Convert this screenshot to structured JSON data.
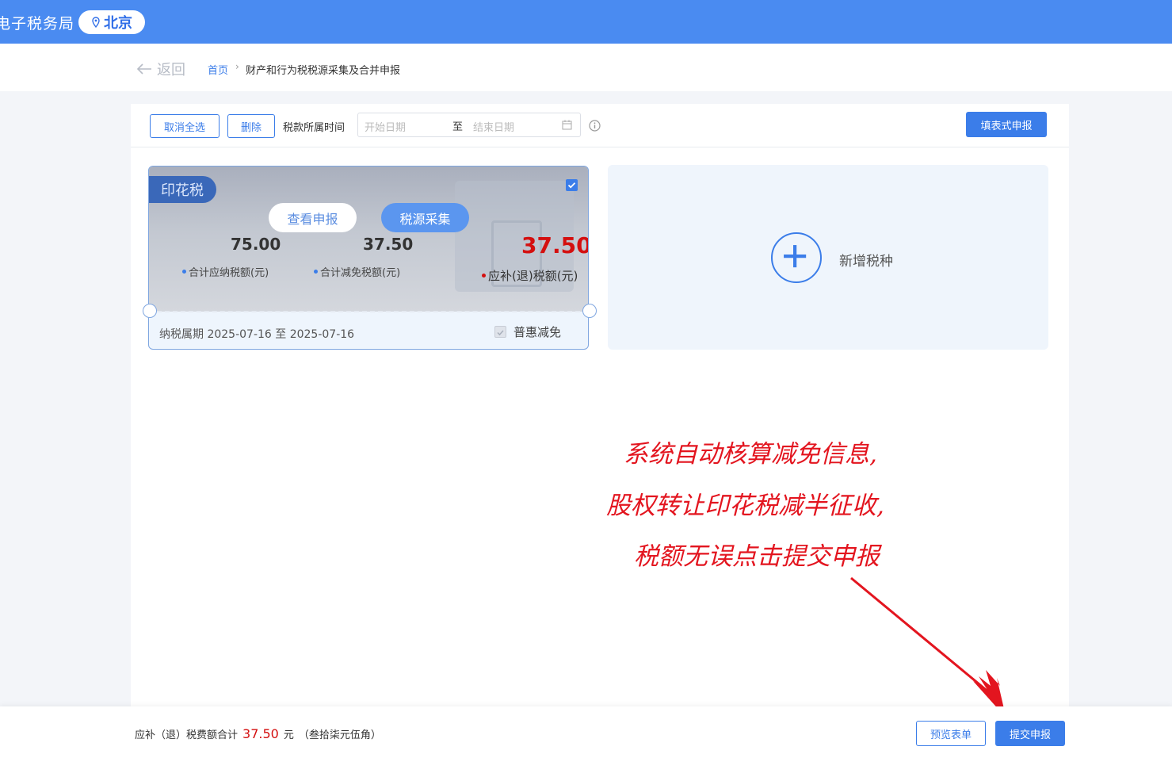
{
  "header": {
    "brand": "电子税务局",
    "location": "北京"
  },
  "breadcrumb": {
    "back": "返回",
    "home": "首页",
    "separator": "›",
    "current": "财产和行为税税源采集及合并申报"
  },
  "toolbar": {
    "cancel_select_all": "取消全选",
    "delete": "删除",
    "tax_period_label": "税款所属时间",
    "start_placeholder": "开始日期",
    "range_to": "至",
    "end_placeholder": "结束日期",
    "form_declare": "填表式申报"
  },
  "tax_card": {
    "name": "印花税",
    "checked": true,
    "view_declaration": "查看申报",
    "source_collection": "税源采集",
    "total_tax_value": "75.00",
    "total_tax_label": "合计应纳税额(元)",
    "total_relief_value": "37.50",
    "total_relief_label": "合计减免税额(元)",
    "payable_value": "37.50",
    "payable_label": "应补(退)税额(元)",
    "period": "纳税属期 2025-07-16 至 2025-07-16",
    "relief_option": "普惠减免"
  },
  "add_card": {
    "label": "新增税种"
  },
  "annotation": {
    "line1": "系统自动核算减免信息,",
    "line2": "股权转让印花税减半征收,",
    "line3": "税额无误点击提交申报"
  },
  "footer": {
    "total_label": "应补（退）税费额合计",
    "total_amount": "37.50",
    "unit": "元",
    "amount_words": "（叁拾柒元伍角）",
    "preview": "预览表单",
    "submit": "提交申报"
  },
  "colors": {
    "brand": "#4a8bf1",
    "accent": "#3b7de9",
    "amount_red": "#d40f0f",
    "annotation_red": "#e3151f"
  }
}
